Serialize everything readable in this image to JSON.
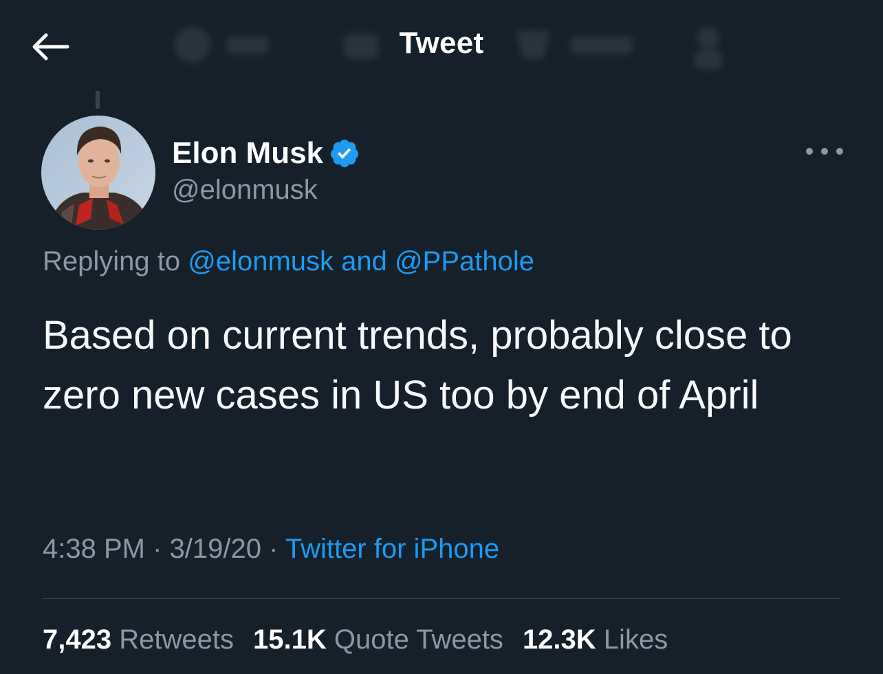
{
  "header": {
    "title": "Tweet",
    "back_icon": "back-arrow-icon"
  },
  "tweet": {
    "display_name": "Elon Musk",
    "handle": "@elonmusk",
    "verified_color": "#1d9bf0",
    "replying": {
      "prefix": "Replying to",
      "mention1": "@elonmusk",
      "joiner": "and",
      "mention2": "@PPathole"
    },
    "text": "Based on current trends, probably close to zero new cases in US too by end of April",
    "time": "4:38 PM",
    "date": "3/19/20",
    "separator": "·",
    "source": "Twitter for iPhone"
  },
  "stats": {
    "retweets_count": "7,423",
    "retweets_label": "Retweets",
    "quotes_count": "15.1K",
    "quotes_label": "Quote Tweets",
    "likes_count": "12.3K",
    "likes_label": "Likes"
  },
  "colors": {
    "background": "#15202b",
    "accent": "#1d9bf0",
    "muted": "#8b98a5",
    "divider": "#38444d"
  }
}
